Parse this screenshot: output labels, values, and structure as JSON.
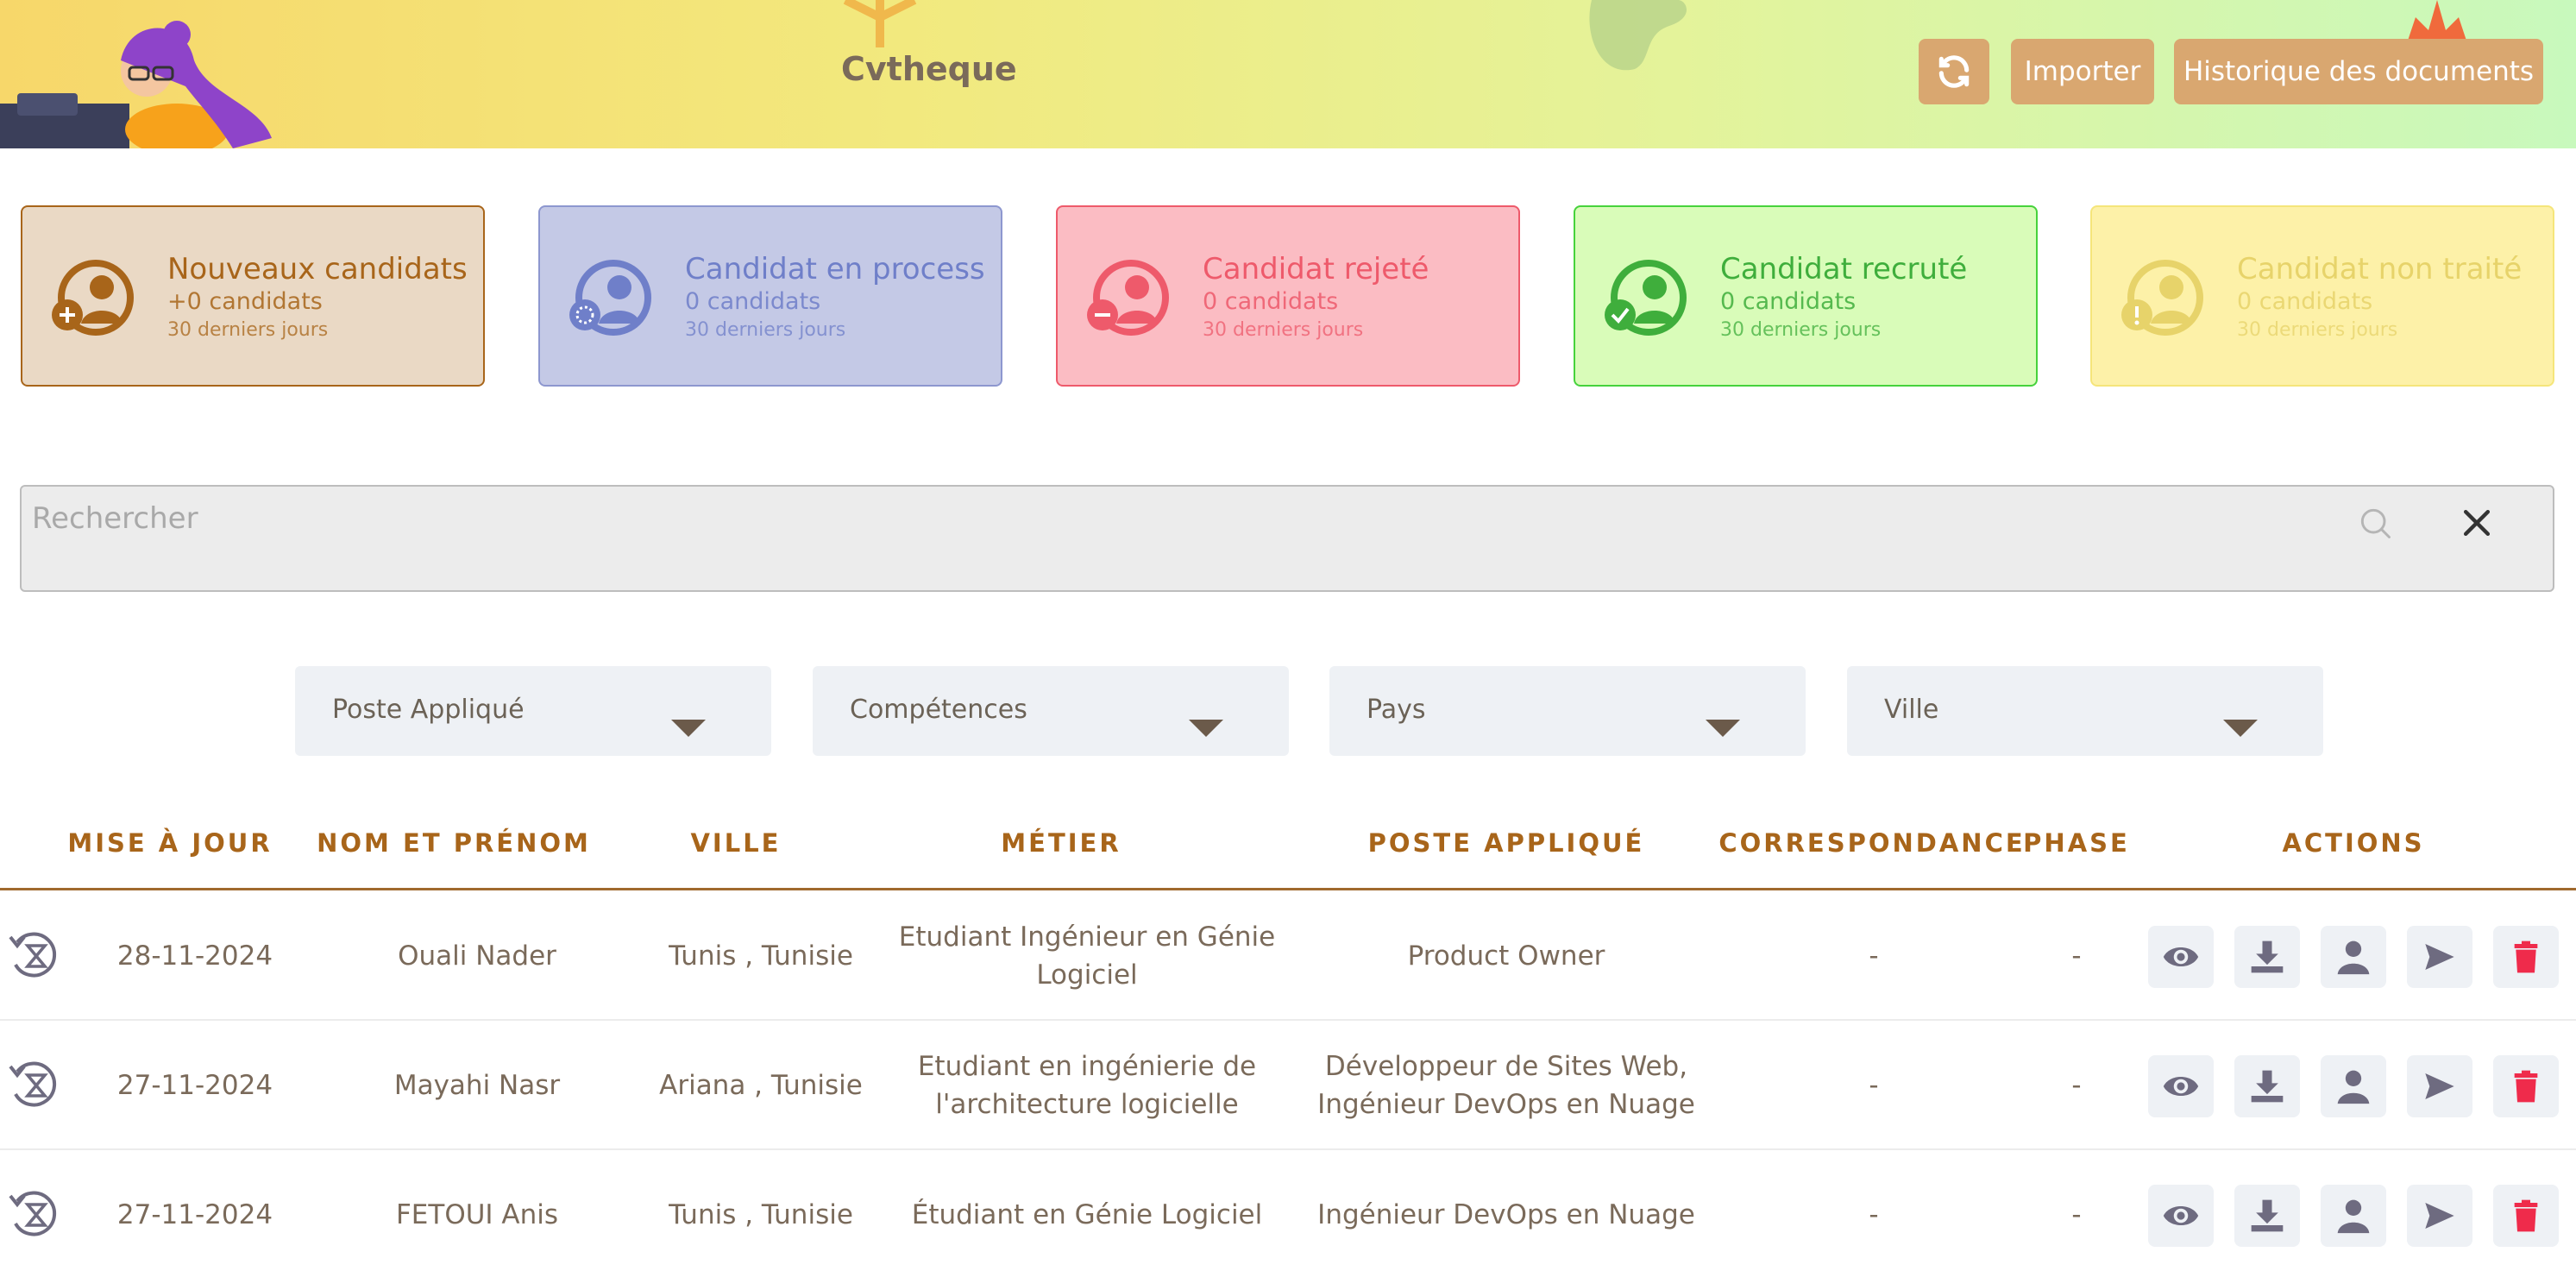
{
  "header": {
    "title": "Cvtheque",
    "import_label": "Importer",
    "history_label": "Historique des documents",
    "refresh_icon": "refresh-icon"
  },
  "stats": [
    {
      "title": "Nouveaux candidats",
      "count": "+0 candidats",
      "period": "30 derniers jours",
      "bg": "#ead9c5",
      "border": "#a8651a",
      "color": "#a8651a",
      "icon": "user-add-icon"
    },
    {
      "title": "Candidat en process",
      "count": "0 candidats",
      "period": "30 derniers jours",
      "bg": "#c4c9e6",
      "border": "#8d97cf",
      "color": "#6f7fc9",
      "icon": "user-process-icon"
    },
    {
      "title": "Candidat rejeté",
      "count": "0 candidats",
      "period": "30 derniers jours",
      "bg": "#fbbcc3",
      "border": "#ee5a6b",
      "color": "#ee5a6b",
      "icon": "user-reject-icon"
    },
    {
      "title": "Candidat recruté",
      "count": "0 candidats",
      "period": "30 derniers jours",
      "bg": "#d9fcb9",
      "border": "#46d23c",
      "color": "#3fae3c",
      "icon": "user-check-icon"
    },
    {
      "title": "Candidat non traité",
      "count": "0 candidats",
      "period": "30 derniers jours",
      "bg": "#fdf1a8",
      "border": "#f5e57a",
      "color": "#e7d36a",
      "icon": "user-warning-icon"
    }
  ],
  "search": {
    "placeholder": "Rechercher"
  },
  "filters": [
    "Poste Appliqué",
    "Compétences",
    "Pays",
    "Ville"
  ],
  "table": {
    "columns": [
      "MISE À JOUR",
      "NOM ET PRÉNOM",
      "VILLE",
      "MÉTIER",
      "POSTE APPLIQUÉ",
      "CORRESPONDANCE",
      "PHASE",
      "ACTIONS"
    ],
    "rows": [
      {
        "date": "28-11-2024",
        "name": "Ouali Nader",
        "city": "Tunis , Tunisie",
        "job": "Etudiant Ingénieur en Génie Logiciel",
        "position": "Product Owner",
        "match": "-",
        "phase": "-"
      },
      {
        "date": "27-11-2024",
        "name": "Mayahi Nasr",
        "city": "Ariana , Tunisie",
        "job": "Etudiant en ingénierie de l'architecture logicielle",
        "position": "Développeur de Sites Web, Ingénieur DevOps en Nuage",
        "match": "-",
        "phase": "-"
      },
      {
        "date": "27-11-2024",
        "name": "FETOUI Anis",
        "city": "Tunis , Tunisie",
        "job": "Étudiant en Génie Logiciel",
        "position": "Ingénieur DevOps en Nuage",
        "match": "-",
        "phase": "-"
      }
    ],
    "action_icons": [
      "eye-icon",
      "download-icon",
      "user-icon",
      "send-icon",
      "trash-icon"
    ]
  },
  "colors": {
    "accent": "#d9a770",
    "header_text": "#a8651a",
    "delete": "#ef2b4b"
  }
}
